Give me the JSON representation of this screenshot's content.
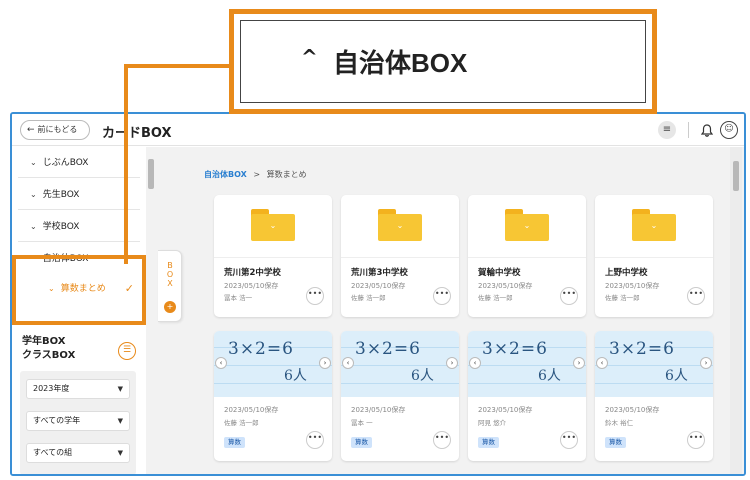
{
  "callout": {
    "chevron": "^",
    "title": "自治体BOX"
  },
  "topbar": {
    "back_label": "前にもどる",
    "back_arrow": "←",
    "app_title": "カードBOX",
    "icons": [
      "menu-icon",
      "bell-icon",
      "user-icon"
    ]
  },
  "sidebar": {
    "items": [
      {
        "chevron": "⌄",
        "label": "じぶんBOX"
      },
      {
        "chevron": "⌄",
        "label": "先生BOX"
      },
      {
        "chevron": "⌄",
        "label": "学校BOX"
      },
      {
        "chevron": "^",
        "label": "自治体BOX"
      },
      {
        "chevron": "⌄",
        "label": "算数まとめ",
        "check": "✓"
      }
    ],
    "filter_heading_1": "学年BOX",
    "filter_heading_2": "クラスBOX",
    "filter_icon": "filter-icon",
    "selects": [
      {
        "value": "2023年度"
      },
      {
        "value": "すべての学年"
      },
      {
        "value": "すべての組"
      }
    ]
  },
  "box_tab": {
    "label": "BOX",
    "badge": "+"
  },
  "breadcrumb": {
    "root": "自治体BOX",
    "sep": ">",
    "current": "算数まとめ"
  },
  "folders": [
    {
      "title": "荒川第2中学校",
      "date": "2023/05/10保存",
      "name": "冨本 浩一"
    },
    {
      "title": "荒川第3中学校",
      "date": "2023/05/10保存",
      "name": "佐藤 浩一郎"
    },
    {
      "title": "賀輪中学校",
      "date": "2023/05/10保存",
      "name": "佐藤 浩一郎"
    },
    {
      "title": "上野中学校",
      "date": "2023/05/10保存",
      "name": "佐藤 浩一郎"
    }
  ],
  "notes": [
    {
      "math1": "3×2=6",
      "math2": "6人",
      "date": "2023/05/10保存",
      "name": "佐藤 浩一郎",
      "tag": "算数"
    },
    {
      "math1": "3×2=6",
      "math2": "6人",
      "date": "2023/05/10保存",
      "name": "冨本 一",
      "tag": "算数"
    },
    {
      "math1": "3×2=6",
      "math2": "6人",
      "date": "2023/05/10保存",
      "name": "阿見 悠介",
      "tag": "算数"
    },
    {
      "math1": "3×2=6",
      "math2": "6人",
      "date": "2023/05/10保存",
      "name": "鈴木 裕仁",
      "tag": "算数"
    }
  ],
  "more_label": "•••",
  "accent_color": "#e88a1a",
  "link_color": "#2a7fd0",
  "frame_color": "#3a8fd6"
}
